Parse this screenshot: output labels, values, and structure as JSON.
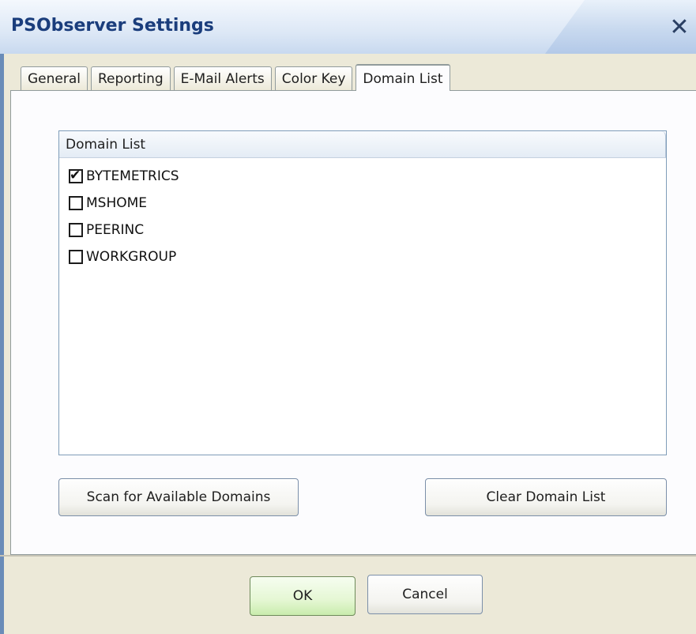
{
  "window": {
    "title": "PSObserver Settings",
    "close_symbol": "✕"
  },
  "tabs": [
    {
      "label": "General",
      "active": false
    },
    {
      "label": "Reporting",
      "active": false
    },
    {
      "label": "E-Mail Alerts",
      "active": false
    },
    {
      "label": "Color Key",
      "active": false
    },
    {
      "label": "Domain List",
      "active": true
    }
  ],
  "domain_list": {
    "header": "Domain List",
    "items": [
      {
        "label": "BYTEMETRICS",
        "checked": true
      },
      {
        "label": "MSHOME",
        "checked": false
      },
      {
        "label": "PEERINC",
        "checked": false
      },
      {
        "label": "WORKGROUP",
        "checked": false
      }
    ]
  },
  "buttons": {
    "scan": "Scan for Available Domains",
    "clear": "Clear Domain List",
    "ok": "OK",
    "cancel": "Cancel"
  },
  "colors": {
    "title": "#1a3d7c",
    "active_tab_accent": "#e8a33d",
    "ok_button": "#e5f7d4"
  }
}
